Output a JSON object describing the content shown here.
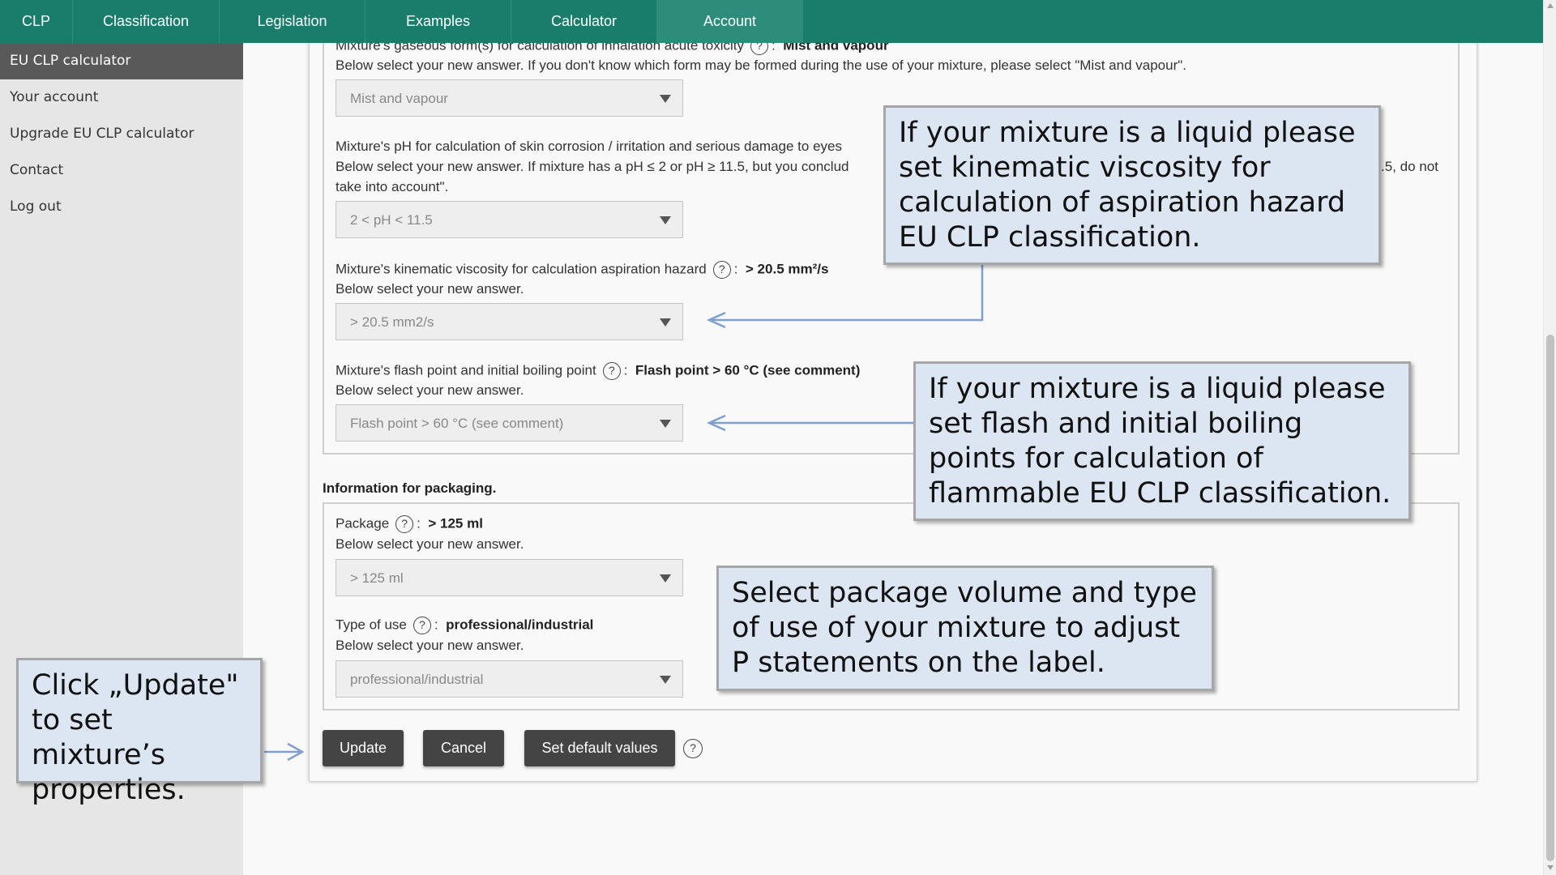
{
  "topnav": {
    "items": [
      {
        "label": "CLP",
        "active": false
      },
      {
        "label": "Classification",
        "active": false
      },
      {
        "label": "Legislation",
        "active": false
      },
      {
        "label": "Examples",
        "active": false
      },
      {
        "label": "Calculator",
        "active": false
      },
      {
        "label": "Account",
        "active": true
      }
    ]
  },
  "sidebar": {
    "items": [
      {
        "label": "EU CLP calculator",
        "active": true
      },
      {
        "label": "Your account",
        "active": false
      },
      {
        "label": "Upgrade EU CLP calculator",
        "active": false
      },
      {
        "label": "Contact",
        "active": false
      },
      {
        "label": "Log out",
        "active": false
      }
    ]
  },
  "form": {
    "gaseous": {
      "question": "Mixture's gaseous form(s) for calculation of inhalation acute toxicity",
      "current": "Mist and vapour",
      "instruction": "Below select your new answer. If you don't know which form may be formed during the use of your mixture, please select \"Mist and vapour\".",
      "selected": "Mist and vapour"
    },
    "ph": {
      "question": "Mixture's pH for calculation of skin corrosion / irritation and serious damage to eyes",
      "instruction_start": "Below select your new answer. If mixture has a pH ≤ 2 or pH ≥ 11.5, but you conclud",
      "instruction_end": ".5, do not",
      "instruction_line2": "take into account\".",
      "selected": "2 < pH < 11.5"
    },
    "viscosity": {
      "question": "Mixture's kinematic viscosity for calculation aspiration hazard",
      "current": "> 20.5 mm²/s",
      "instruction": "Below select your new answer.",
      "selected": "> 20.5 mm2/s"
    },
    "flash": {
      "question": "Mixture's flash point and initial boiling point",
      "current": "Flash point > 60 °C (see comment)",
      "instruction": "Below select your new answer.",
      "selected": "Flash point > 60 °C (see comment)"
    },
    "packaging_heading": "Information for packaging.",
    "package": {
      "question": "Package",
      "current": "> 125 ml",
      "instruction": "Below select your new answer.",
      "selected": "> 125 ml"
    },
    "use": {
      "question": "Type of use",
      "current": "professional/industrial",
      "instruction": "Below select your new answer.",
      "selected": "professional/industrial"
    },
    "help_glyph": "?",
    "colon": ":"
  },
  "buttons": {
    "update": "Update",
    "cancel": "Cancel",
    "defaults": "Set default values"
  },
  "callouts": {
    "viscosity": "If your mixture is a liquid please set kinematic viscosity for calculation of aspiration hazard EU CLP classification.",
    "flash": "If your mixture is a liquid please set flash and initial boiling points for calculation of flammable EU CLP classification.",
    "package": "Select package volume and type of use of your mixture to adjust P statements on the label.",
    "update": "Click „Update\" to set mixture’s properties."
  },
  "colors": {
    "nav_bg": "#1a7d6b",
    "callout_bg": "#dce6f2",
    "arrow": "#7f9fd0",
    "button_bg": "#444444"
  }
}
